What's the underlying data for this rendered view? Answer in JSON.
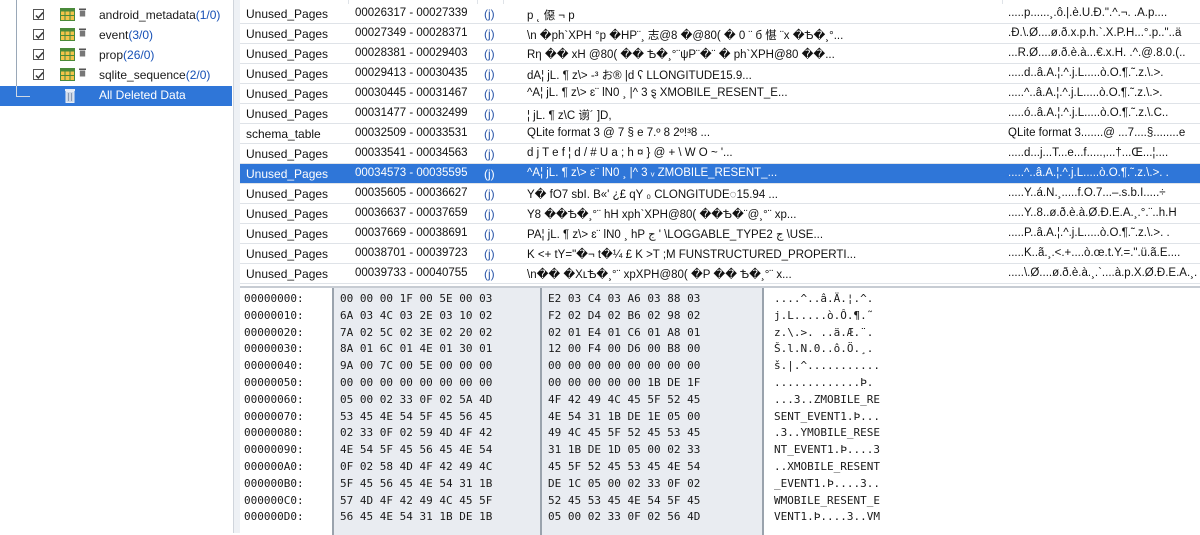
{
  "tree": {
    "items": [
      {
        "name": "android_metadata",
        "count": "(1/0)"
      },
      {
        "name": "event",
        "count": "(3/0)"
      },
      {
        "name": "prop",
        "count": "(26/0)"
      },
      {
        "name": "sqlite_sequence",
        "count": "(2/0)"
      }
    ],
    "deleted_label": "All Deleted Data",
    "selection_color": "#2f76d8"
  },
  "grid": {
    "rows": [
      {
        "type": "Unused_Pages",
        "range": "00026317 - 00027339",
        "flag": "(j)",
        "content": "p    ˛ 僫   ¬  p",
        "ascii": ".....p......¸.ô.|.è.Ü.Ð.\".^.¬. .Ä.p...."
      },
      {
        "type": "Unused_Pages",
        "range": "00027349 - 00028371",
        "flag": "(j)",
        "content": "\\n  �ph`XPH °p  �HP¨¸ 志@8  �@80(  �  0  ¨ б 愖 ¨x  �Ѣ�¸°...",
        "ascii": ".Ð.\\.Ø....ø.ð.x.p.h.`.X.P.H...°.p..\"..ä"
      },
      {
        "type": "Unused_Pages",
        "range": "00028381 - 00029403",
        "flag": "(j)",
        "content": "Rη  ��  xH   @80(       ��  Ѣ�¸°¨ψP¨�¨  �  ph`XPH@80   ��...",
        "ascii": "...R.Ø....ø.ð.è.à...€.x.H. .^.@.8.0.(.."
      },
      {
        "type": "Unused_Pages",
        "range": "00029413 - 00030435",
        "flag": "(j)",
        "content": "dA¦ jL.  ¶ z\\>   -³  お®  |d                     ʕ    LLONGITUDE15.9...",
        "ascii": ".....d..â.Ä.¦.^.j.L.....ò.Ô.¶.˜.z.\\.>. "
      },
      {
        "type": "Unused_Pages",
        "range": "00030445 - 00031467",
        "flag": "(j)",
        "content": "^A¦ jL.  ¶ z\\>   ɛ¨ lN0   ¸ |^               3  ȿ XMOBILE_RESENT_E...",
        "ascii": ".....^..â.Ä.¦.^.j.L.....ò.Ô.¶.˜.z.\\.>. "
      },
      {
        "type": "Unused_Pages",
        "range": "00031477 - 00032499",
        "flag": "(j)",
        "content": "¦ jL.  ¶ z\\C 谫´  ]D,",
        "ascii": ".....ó..â.Ä.¦.^.j.L.....ò.Ô.¶.˜.z.\\.C.."
      },
      {
        "type": "schema_table",
        "range": "00032509 - 00033531",
        "flag": "(j)",
        "content": "QLite format 3    @   7  §     e                              7.º   8  2º!³8 ...",
        "ascii": "QLite format 3.......@  ...7....§........e"
      },
      {
        "type": "Unused_Pages",
        "range": "00033541 - 00034563",
        "flag": "(j)",
        "content": "d j T e f       ¦ d / #    U a ; h ¤ } @ +    \\ W O    ~    '...",
        "ascii": ".....d...j...T...e...f.....,...†...Œ...¦...."
      },
      {
        "type": "Unused_Pages",
        "range": "00034573 - 00035595",
        "flag": "(j)",
        "content": "^A¦ jL.  ¶ z\\>   ɛ¨ lN0   ¸ |^               3  ᵥ ZMOBILE_RESENT_...",
        "ascii": ".....^..â.Ä.¦.^.j.L.....ò.Ô.¶.˜.z.\\.>. ."
      },
      {
        "type": "Unused_Pages",
        "range": "00035605 - 00036627",
        "flag": "(j)",
        "content": "Y�   fO7  sbI.   B«' ¿£ qY                         ₀    CLONGITUDE◌15.94 ...",
        "ascii": ".....Y..á.Ñ.¸.....f.O.7...–.s.b.I.....÷"
      },
      {
        "type": "Unused_Pages",
        "range": "00036637 - 00037659",
        "flag": "(j)",
        "content": "Y8 ��Ѣ�¸°¨   hH     xph`XPH@80(        ��Ѣ�¨@¸°¨        xp...",
        "ascii": ".....Y..8..ø.ð.è.à.Ø.Ð.È.À.¸.°.¨..h.H"
      },
      {
        "type": "Unused_Pages",
        "range": "00037669 - 00038691",
        "flag": "(j)",
        "content": "PA¦ jL.  ¶ z\\>   ɛ¨ lN0   ¸   hP       ج ' \\LOGGABLE_TYPE2 ج    \\USE...",
        "ascii": ".....P..â.Ä.¦.^.j.L.....ò.Ô.¶.˜.z.\\.>. ."
      },
      {
        "type": "Unused_Pages",
        "range": "00038701 - 00039723",
        "flag": "(j)",
        "content": "K  <+  tY=\"�¬  t�¼ £ K                          >T  ;M FUNSTRUCTURED_PROPERTI...",
        "ascii": ".....K..ã.¸.<.+....ò.œ.t.Y.=.\".ü.ã.Ë...."
      },
      {
        "type": "Unused_Pages",
        "range": "00039733 - 00040755",
        "flag": "(j)",
        "content": "\\n��    �XʟѢ�¸°¨         xpXPH@80(   �P          ��  Ѣ�¸°¨       x...",
        "ascii": ".....\\.Ø....ø.ð.è.à.¸.`....à.p.X.Ø.Ð.È.À.¸."
      }
    ],
    "selected_index": 8
  },
  "hex": {
    "lines": [
      {
        "addr": "00000000:",
        "b1": "00 00 00 1F 00 5E 00 03",
        "b2": "E2 03 C4 03 A6 03 88 03",
        "ascii": "....^..â.Ä.¦.^."
      },
      {
        "addr": "00000010:",
        "b1": "6A 03 4C 03 2E 03 10 02",
        "b2": "F2 02 D4 02 B6 02 98 02",
        "ascii": "j.L.....ò.Ô.¶.˜"
      },
      {
        "addr": "00000020:",
        "b1": "7A 02 5C 02 3E 02 20 02",
        "b2": "02 01 E4 01 C6 01 A8 01",
        "ascii": "z.\\.>. ..ä.Æ.¨."
      },
      {
        "addr": "00000030:",
        "b1": "8A 01 6C 01 4E 01 30 01",
        "b2": "12 00 F4 00 D6 00 B8 00",
        "ascii": "Š.l.N.0..ô.Ö.¸."
      },
      {
        "addr": "00000040:",
        "b1": "9A 00 7C 00 5E 00 00 00",
        "b2": "00 00 00 00 00 00 00 00",
        "ascii": "š.|.^..........."
      },
      {
        "addr": "00000050:",
        "b1": "00 00 00 00 00 00 00 00",
        "b2": "00 00 00 00 00 1B DE 1F",
        "ascii": ".............Þ."
      },
      {
        "addr": "00000060:",
        "b1": "05 00 02 33 0F 02 5A 4D",
        "b2": "4F 42 49 4C 45 5F 52 45",
        "ascii": "...3..ZMOBILE_RE"
      },
      {
        "addr": "00000070:",
        "b1": "53 45 4E 54 5F 45 56 45",
        "b2": "4E 54 31 1B DE 1E 05 00",
        "ascii": "SENT_EVENT1.Þ..."
      },
      {
        "addr": "00000080:",
        "b1": "02 33 0F 02 59 4D 4F 42",
        "b2": "49 4C 45 5F 52 45 53 45",
        "ascii": ".3..YMOBILE_RESE"
      },
      {
        "addr": "00000090:",
        "b1": "4E 54 5F 45 56 45 4E 54",
        "b2": "31 1B DE 1D 05 00 02 33",
        "ascii": "NT_EVENT1.Þ....3"
      },
      {
        "addr": "000000A0:",
        "b1": "0F 02 58 4D 4F 42 49 4C",
        "b2": "45 5F 52 45 53 45 4E 54",
        "ascii": "..XMOBILE_RESENT"
      },
      {
        "addr": "000000B0:",
        "b1": "5F 45 56 45 4E 54 31 1B",
        "b2": "DE 1C 05 00 02 33 0F 02",
        "ascii": "_EVENT1.Þ....3.."
      },
      {
        "addr": "000000C0:",
        "b1": "57 4D 4F 42 49 4C 45 5F",
        "b2": "52 45 53 45 4E 54 5F 45",
        "ascii": "WMOBILE_RESENT_E"
      },
      {
        "addr": "000000D0:",
        "b1": "56 45 4E 54 31 1B DE 1B",
        "b2": "05 00 02 33 0F 02 56 4D",
        "ascii": "VENT1.Þ....3..VM"
      }
    ]
  }
}
